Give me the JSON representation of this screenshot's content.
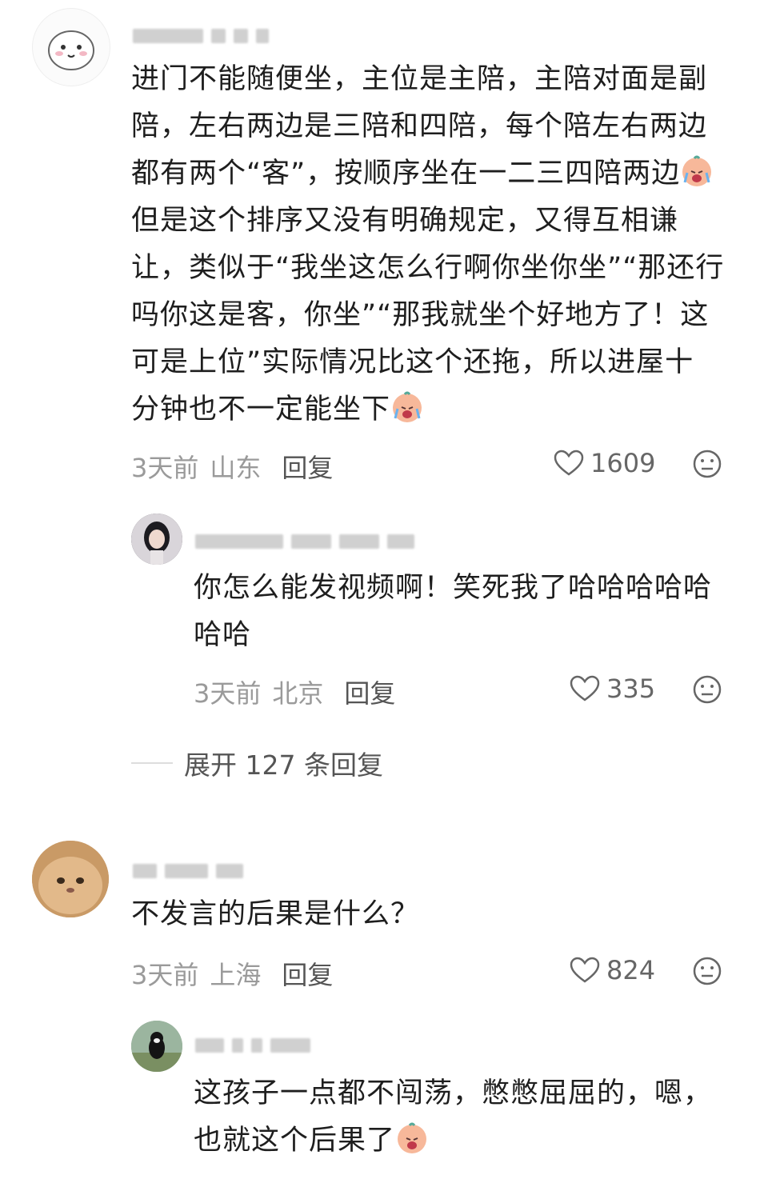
{
  "comments": [
    {
      "text_lines": [
        "进门不能随便坐，主位是主陪，主陪对面是副",
        "陪，左右两边是三陪和四陪，每个陪左右两边",
        "都有两个“客”，按顺序坐在一二三四陪两边",
        "但是这个排序又没有明确规定，又得互相谦",
        "让，类似于“我坐这怎么行啊你坐你坐”“那还行",
        "吗你这是客，你坐”“那我就坐个好地方了！这",
        "可是上位”实际情况比这个还拖，所以进屋十",
        "分钟也不一定能坐下"
      ],
      "time": "3天前",
      "location": "山东",
      "reply": "回复",
      "likes": "1609"
    },
    {
      "text_lines": [
        "你怎么能发视频啊！笑死我了哈哈哈哈哈",
        "哈哈"
      ],
      "time": "3天前",
      "location": "北京",
      "reply": "回复",
      "likes": "335"
    },
    {
      "text_lines": [
        "不发言的后果是什么？"
      ],
      "time": "3天前",
      "location": "上海",
      "reply": "回复",
      "likes": "824"
    },
    {
      "text_lines": [
        "这孩子一点都不闯荡，憋憋屈屈的，嗯，",
        "也就这个后果了"
      ]
    }
  ],
  "expand_label": "展开 127 条回复",
  "colors": {
    "meta": "#9a9a9a",
    "text": "#1e1e1e",
    "reply": "#555555"
  },
  "icons": [
    "like-icon",
    "dislike-icon",
    "crying-emoji"
  ]
}
